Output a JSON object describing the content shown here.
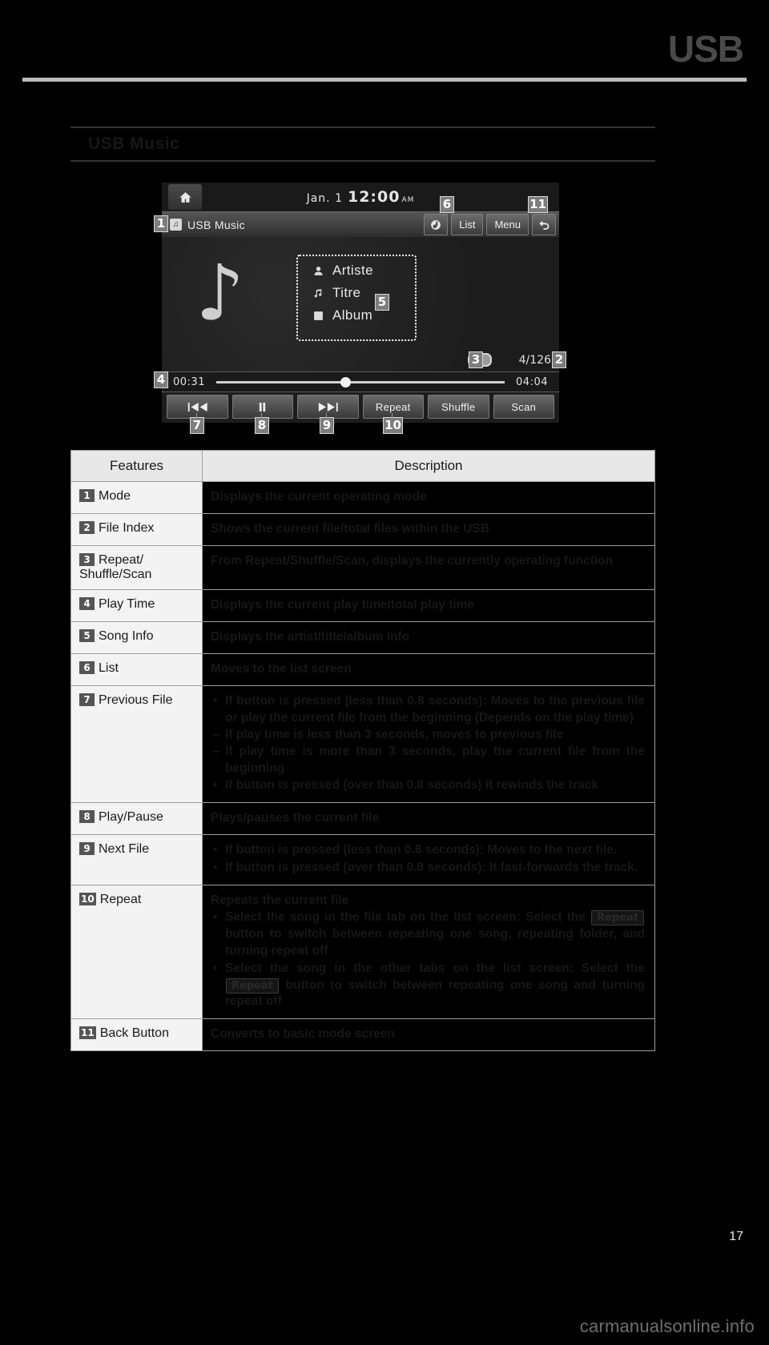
{
  "page": {
    "chapter": "USB",
    "section_title": "USB Music",
    "page_number": "17",
    "watermark": "carmanualsonline.info"
  },
  "device": {
    "status": {
      "date": "Jan.  1",
      "time": "12:00",
      "ampm": "AM",
      "home_icon": "home-icon"
    },
    "titlebar": {
      "mode_icon": "usb-music-icon",
      "mode_label": "USB Music",
      "sound_button": "sound-icon",
      "list_button": "List",
      "menu_button": "Menu",
      "back_button": "back-arrow-icon"
    },
    "album_art_icon": "music-note-icon",
    "song_info": [
      {
        "icon": "artist-icon",
        "text": "Artiste"
      },
      {
        "icon": "title-icon",
        "text": "Titre"
      },
      {
        "icon": "album-icon",
        "text": "Album"
      }
    ],
    "repeat_indicator": "repeat-indicator-icon",
    "file_index": "4/126",
    "play_time": {
      "current": "00:31",
      "total": "04:04",
      "progress_percent": 43
    },
    "controls": [
      {
        "name": "previous-file-button",
        "icon": "skip-previous-icon",
        "label": ""
      },
      {
        "name": "play-pause-button",
        "icon": "pause-icon",
        "label": ""
      },
      {
        "name": "next-file-button",
        "icon": "skip-next-icon",
        "label": ""
      },
      {
        "name": "repeat-button",
        "icon": "",
        "label": "Repeat"
      },
      {
        "name": "shuffle-button",
        "icon": "",
        "label": "Shuffle"
      },
      {
        "name": "scan-button",
        "icon": "",
        "label": "Scan"
      }
    ],
    "callouts": [
      "1",
      "2",
      "3",
      "4",
      "5",
      "6",
      "7",
      "8",
      "9",
      "10",
      "11"
    ]
  },
  "table": {
    "headers": {
      "features": "Features",
      "description": "Description"
    },
    "rows": [
      {
        "num": "1",
        "feature": "Mode",
        "desc_plain": "Displays the current operating mode"
      },
      {
        "num": "2",
        "feature": "File Index",
        "desc_plain": "Shows the current file/total files within the USB"
      },
      {
        "num": "3",
        "feature": "Repeat/ Shuffle/Scan",
        "desc_plain": "From Repeat/Shuffle/Scan, displays the currently operating function"
      },
      {
        "num": "4",
        "feature": "Play Time",
        "desc_plain": "Displays the current play time/total play time"
      },
      {
        "num": "5",
        "feature": "Song Info",
        "desc_plain": "Displays the artist/title/album info"
      },
      {
        "num": "6",
        "feature": "List",
        "desc_plain": "Moves to the list screen"
      },
      {
        "num": "7",
        "feature": "Previous File",
        "bullets": [
          "If button is pressed (less than 0.8 seconds): Moves to the previous file or play the current file from the beginning (Depends on the play time)",
          "If button is pressed (over than 0.8 seconds) it rewinds the track"
        ],
        "dashes": [
          "If play time is less than 3 seconds, moves to previous file",
          "If play time is more than 3 seconds, play the current file from the beginning"
        ]
      },
      {
        "num": "8",
        "feature": "Play/Pause",
        "desc_plain": "Plays/pauses the current file"
      },
      {
        "num": "9",
        "feature": "Next File",
        "bullets": [
          "If button is pressed (less than 0.8 seconds): Moves to the next file.",
          "If button is pressed (over than 0.8 seconds): It fast-forwards the track."
        ]
      },
      {
        "num": "10",
        "feature": "Repeat",
        "lead": "Repeats the current file",
        "bullets_rich": [
          {
            "pre": "Select the song in the file tab on the list screen: Select the ",
            "btn": "Repeat",
            "post": " button to switch between repeating one song, repeating folder, and turning repeat off"
          },
          {
            "pre": "Select the song in the other tabs on the list screen: Select the ",
            "btn": "Repeat",
            "post": " button to switch between repeating one song and turning repeat off"
          }
        ]
      },
      {
        "num": "11",
        "feature": "Back Button",
        "desc_plain": "Converts to basic mode screen"
      }
    ]
  }
}
